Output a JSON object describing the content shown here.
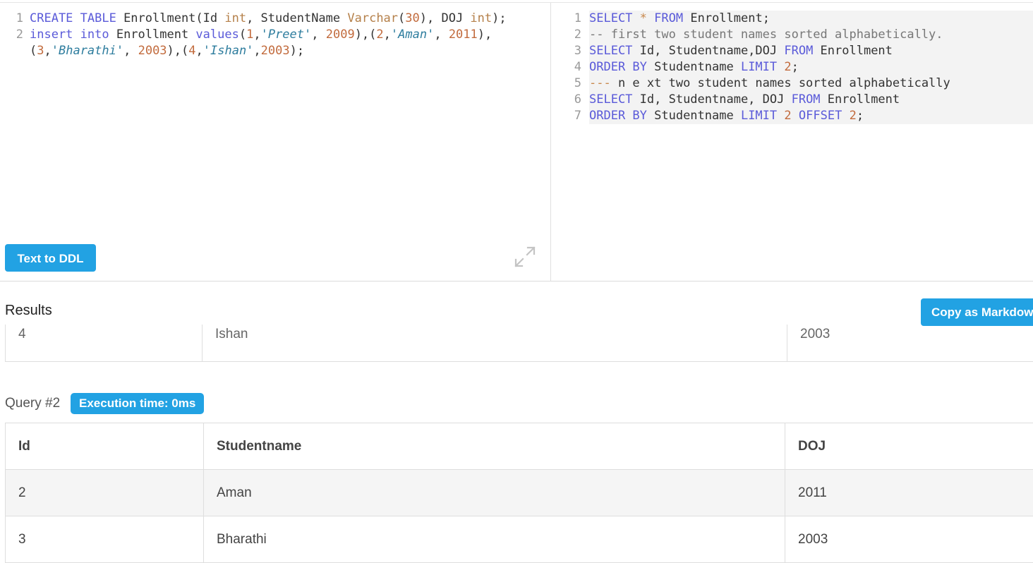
{
  "schema_editor": {
    "lines": [
      {
        "num": "1",
        "tokens": [
          {
            "t": "CREATE TABLE",
            "c": "kw"
          },
          {
            "t": " Enrollment(Id ",
            "c": ""
          },
          {
            "t": "int",
            "c": "ty"
          },
          {
            "t": ", StudentName ",
            "c": ""
          },
          {
            "t": "Varchar",
            "c": "ty"
          },
          {
            "t": "(",
            "c": ""
          },
          {
            "t": "30",
            "c": "nu"
          },
          {
            "t": "), DOJ ",
            "c": ""
          },
          {
            "t": "int",
            "c": "ty"
          },
          {
            "t": ");",
            "c": ""
          }
        ]
      },
      {
        "num": "2",
        "tokens": [
          {
            "t": "insert into",
            "c": "kw"
          },
          {
            "t": " Enrollment ",
            "c": ""
          },
          {
            "t": "values",
            "c": "kw"
          },
          {
            "t": "(",
            "c": ""
          },
          {
            "t": "1",
            "c": "nu"
          },
          {
            "t": ",",
            "c": ""
          },
          {
            "t": "'Preet'",
            "c": "st"
          },
          {
            "t": ", ",
            "c": ""
          },
          {
            "t": "2009",
            "c": "nu"
          },
          {
            "t": "),(",
            "c": ""
          },
          {
            "t": "2",
            "c": "nu"
          },
          {
            "t": ",",
            "c": ""
          },
          {
            "t": "'Aman'",
            "c": "st"
          },
          {
            "t": ", ",
            "c": ""
          },
          {
            "t": "2011",
            "c": "nu"
          },
          {
            "t": "),",
            "c": ""
          }
        ]
      },
      {
        "num": "",
        "tokens": [
          {
            "t": "(",
            "c": ""
          },
          {
            "t": "3",
            "c": "nu"
          },
          {
            "t": ",",
            "c": ""
          },
          {
            "t": "'Bharathi'",
            "c": "st"
          },
          {
            "t": ", ",
            "c": ""
          },
          {
            "t": "2003",
            "c": "nu"
          },
          {
            "t": "),(",
            "c": ""
          },
          {
            "t": "4",
            "c": "nu"
          },
          {
            "t": ",",
            "c": ""
          },
          {
            "t": "'Ishan'",
            "c": "st"
          },
          {
            "t": ",",
            "c": ""
          },
          {
            "t": "2003",
            "c": "nu"
          },
          {
            "t": ");",
            "c": ""
          }
        ]
      }
    ]
  },
  "query_editor": {
    "lines": [
      {
        "num": "1",
        "tokens": [
          {
            "t": "SELECT",
            "c": "kw"
          },
          {
            "t": " ",
            "c": ""
          },
          {
            "t": "*",
            "c": "cm2"
          },
          {
            "t": " ",
            "c": ""
          },
          {
            "t": "FROM",
            "c": "kw"
          },
          {
            "t": " Enrollment;",
            "c": ""
          }
        ]
      },
      {
        "num": "2",
        "tokens": [
          {
            "t": "-- first two student names sorted alphabetically.",
            "c": "cm"
          }
        ]
      },
      {
        "num": "3",
        "tokens": [
          {
            "t": "SELECT",
            "c": "kw"
          },
          {
            "t": " Id, Studentname,DOJ ",
            "c": ""
          },
          {
            "t": "FROM",
            "c": "kw"
          },
          {
            "t": " Enrollment",
            "c": ""
          }
        ]
      },
      {
        "num": "4",
        "tokens": [
          {
            "t": "ORDER BY",
            "c": "kw"
          },
          {
            "t": " Studentname ",
            "c": ""
          },
          {
            "t": "LIMIT",
            "c": "kw"
          },
          {
            "t": " ",
            "c": ""
          },
          {
            "t": "2",
            "c": "nu"
          },
          {
            "t": ";",
            "c": ""
          }
        ]
      },
      {
        "num": "5",
        "tokens": [
          {
            "t": "---",
            "c": "cm2"
          },
          {
            "t": " n e xt two student names sorted alphabetically",
            "c": ""
          }
        ]
      },
      {
        "num": "6",
        "tokens": [
          {
            "t": "SELECT",
            "c": "kw"
          },
          {
            "t": " Id, Studentname, DOJ ",
            "c": ""
          },
          {
            "t": "FROM",
            "c": "kw"
          },
          {
            "t": " Enrollment",
            "c": ""
          }
        ]
      },
      {
        "num": "7",
        "tokens": [
          {
            "t": "ORDER BY",
            "c": "kw"
          },
          {
            "t": " Studentname ",
            "c": ""
          },
          {
            "t": "LIMIT",
            "c": "kw"
          },
          {
            "t": " ",
            "c": ""
          },
          {
            "t": "2",
            "c": "nu"
          },
          {
            "t": " ",
            "c": ""
          },
          {
            "t": "OFFSET",
            "c": "kw"
          },
          {
            "t": " ",
            "c": ""
          },
          {
            "t": "2",
            "c": "nu"
          },
          {
            "t": ";",
            "c": ""
          }
        ]
      }
    ]
  },
  "buttons": {
    "text_to_ddl": "Text to DDL",
    "copy_markdown": "Copy as Markdown"
  },
  "icons": {
    "expand": "expand-icon"
  },
  "results": {
    "title": "Results",
    "query1_partial_row": [
      "4",
      "Ishan",
      "2003"
    ],
    "query2": {
      "label": "Query #2",
      "execution_time": "Execution time: 0ms",
      "columns": [
        "Id",
        "Studentname",
        "DOJ"
      ],
      "rows": [
        [
          "2",
          "Aman",
          "2011"
        ],
        [
          "3",
          "Bharathi",
          "2003"
        ]
      ]
    }
  },
  "colors": {
    "accent": "#22a2e3",
    "keyword": "#5a5ad9",
    "number": "#c26b3d",
    "string": "#2e7d9e"
  }
}
